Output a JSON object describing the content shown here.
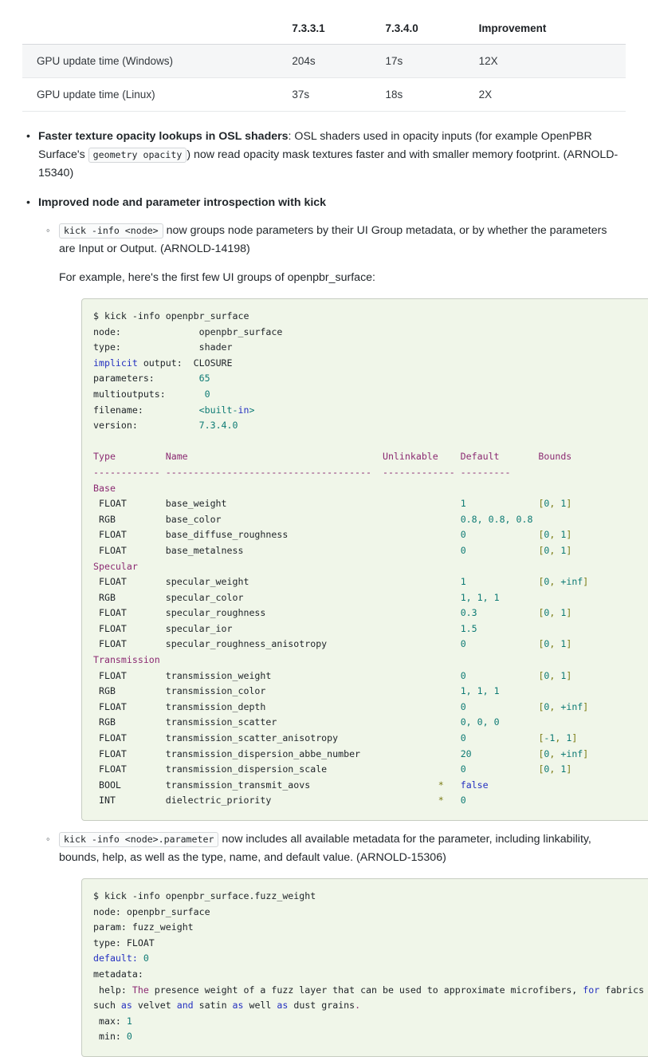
{
  "perf_table": {
    "columns": [
      "",
      "7.3.3.1",
      "7.3.4.0",
      "Improvement"
    ],
    "rows": [
      {
        "label": "GPU update time (Windows)",
        "v731": "204s",
        "v734": "17s",
        "improvement": "12X"
      },
      {
        "label": "GPU update time (Linux)",
        "v731": "37s",
        "v734": "18s",
        "improvement": "2X"
      }
    ]
  },
  "bullets": {
    "item1": {
      "title": "Faster texture opacity lookups in OSL shaders",
      "text_a": ": OSL shaders used in opacity inputs (for example OpenPBR Surface's ",
      "code": "geometry opacity",
      "text_b": ") now read opacity mask textures faster and with smaller memory footprint. (ARNOLD-15340)"
    },
    "item2": {
      "title": "Improved node and parameter introspection with kick",
      "sub1": {
        "code": "kick -info <node>",
        "text": " now groups node parameters by their UI Group metadata, or by whether the parameters are Input or Output. (ARNOLD-14198)",
        "example_intro": "For example, here's the first few UI groups of openpbr_surface:"
      },
      "sub2": {
        "code": "kick -info <node>.parameter",
        "text": " now includes all available metadata for the parameter, including linkability, bounds, help, as well as the type, name, and default value. (ARNOLD-15306)"
      }
    }
  },
  "codeblock1": {
    "command": "$ kick -info openpbr_surface",
    "meta": [
      {
        "key": "node:",
        "key_style": "plain",
        "pad": 14,
        "value": "openpbr_surface",
        "value_style": "plain"
      },
      {
        "key": "type:",
        "key_style": "plain",
        "pad": 14,
        "value": "shader",
        "value_style": "plain"
      },
      {
        "key": "implicit output:",
        "key_style": "kw",
        "pad": 2,
        "value": "CLOSURE",
        "value_style": "plain"
      },
      {
        "key": "parameters:",
        "key_style": "plain",
        "pad": 8,
        "value": "65",
        "value_style": "val"
      },
      {
        "key": "multioutputs:",
        "key_style": "plain",
        "pad": 7,
        "value": "0",
        "value_style": "val"
      },
      {
        "key": "filename:",
        "key_style": "plain",
        "pad": 10,
        "value": "<built-in>",
        "value_style": "builtin"
      },
      {
        "key": "version:",
        "key_style": "plain",
        "pad": 11,
        "value": "7.3.4.0",
        "value_style": "val"
      }
    ],
    "table_headers": [
      "Type",
      "Name",
      "Unlinkable",
      "Default",
      "Bounds"
    ],
    "divider": [
      "------------",
      "-------------------------------------",
      "-------------",
      "---------"
    ],
    "groups": [
      {
        "name": "Base",
        "params": [
          {
            "type": "FLOAT",
            "name": "base_weight",
            "unlinkable": "",
            "default": "1",
            "default_style": "val",
            "bounds": "[0, 1]"
          },
          {
            "type": "RGB",
            "name": "base_color",
            "unlinkable": "",
            "default": "0.8, 0.8, 0.8",
            "default_style": "val",
            "bounds": ""
          },
          {
            "type": "FLOAT",
            "name": "base_diffuse_roughness",
            "unlinkable": "",
            "default": "0",
            "default_style": "val",
            "bounds": "[0, 1]"
          },
          {
            "type": "FLOAT",
            "name": "base_metalness",
            "unlinkable": "",
            "default": "0",
            "default_style": "val",
            "bounds": "[0, 1]"
          }
        ]
      },
      {
        "name": "Specular",
        "params": [
          {
            "type": "FLOAT",
            "name": "specular_weight",
            "unlinkable": "",
            "default": "1",
            "default_style": "val",
            "bounds": "[0, +inf]"
          },
          {
            "type": "RGB",
            "name": "specular_color",
            "unlinkable": "",
            "default": "1, 1, 1",
            "default_style": "val",
            "bounds": ""
          },
          {
            "type": "FLOAT",
            "name": "specular_roughness",
            "unlinkable": "",
            "default": "0.3",
            "default_style": "val",
            "bounds": "[0, 1]"
          },
          {
            "type": "FLOAT",
            "name": "specular_ior",
            "unlinkable": "",
            "default": "1.5",
            "default_style": "val",
            "bounds": ""
          },
          {
            "type": "FLOAT",
            "name": "specular_roughness_anisotropy",
            "unlinkable": "",
            "default": "0",
            "default_style": "val",
            "bounds": "[0, 1]"
          }
        ]
      },
      {
        "name": "Transmission",
        "params": [
          {
            "type": "FLOAT",
            "name": "transmission_weight",
            "unlinkable": "",
            "default": "0",
            "default_style": "val",
            "bounds": "[0, 1]"
          },
          {
            "type": "RGB",
            "name": "transmission_color",
            "unlinkable": "",
            "default": "1, 1, 1",
            "default_style": "val",
            "bounds": ""
          },
          {
            "type": "FLOAT",
            "name": "transmission_depth",
            "unlinkable": "",
            "default": "0",
            "default_style": "val",
            "bounds": "[0, +inf]"
          },
          {
            "type": "RGB",
            "name": "transmission_scatter",
            "unlinkable": "",
            "default": "0, 0, 0",
            "default_style": "val",
            "bounds": ""
          },
          {
            "type": "FLOAT",
            "name": "transmission_scatter_anisotropy",
            "unlinkable": "",
            "default": "0",
            "default_style": "val",
            "bounds": "[-1, 1]"
          },
          {
            "type": "FLOAT",
            "name": "transmission_dispersion_abbe_number",
            "unlinkable": "",
            "default": "20",
            "default_style": "val",
            "bounds": "[0, +inf]"
          },
          {
            "type": "FLOAT",
            "name": "transmission_dispersion_scale",
            "unlinkable": "",
            "default": "0",
            "default_style": "val",
            "bounds": "[0, 1]"
          },
          {
            "type": "BOOL",
            "name": "transmission_transmit_aovs",
            "unlinkable": "*",
            "default": "false",
            "default_style": "kw",
            "bounds": ""
          },
          {
            "type": "INT",
            "name": "dielectric_priority",
            "unlinkable": "*",
            "default": "0",
            "default_style": "val",
            "bounds": ""
          }
        ]
      }
    ]
  },
  "codeblock2": {
    "command": "$ kick -info openpbr_surface.fuzz_weight",
    "lines": [
      {
        "key": "node:",
        "key_style": "plain",
        "value": " openpbr_surface",
        "value_style": "plain"
      },
      {
        "key": "param:",
        "key_style": "plain",
        "value": " fuzz_weight",
        "value_style": "plain"
      },
      {
        "key": "type:",
        "key_style": "plain",
        "value": " FLOAT",
        "value_style": "plain"
      },
      {
        "key": "default:",
        "key_style": "kw",
        "value": " 0",
        "value_style": "val"
      },
      {
        "key": "metadata:",
        "key_style": "plain",
        "value": "",
        "value_style": "plain"
      }
    ],
    "help_label": " help:",
    "help_text_parts": [
      {
        "t": " ",
        "s": "plain"
      },
      {
        "t": "The",
        "s": "pun"
      },
      {
        "t": " presence weight of a fuzz layer that can be used to approximate microfibers, ",
        "s": "plain"
      },
      {
        "t": "for",
        "s": "kw"
      },
      {
        "t": " fabrics such ",
        "s": "plain"
      },
      {
        "t": "as",
        "s": "kw"
      },
      {
        "t": " velvet ",
        "s": "plain"
      },
      {
        "t": "and",
        "s": "kw"
      },
      {
        "t": " satin ",
        "s": "plain"
      },
      {
        "t": "as",
        "s": "kw"
      },
      {
        "t": " well ",
        "s": "plain"
      },
      {
        "t": "as",
        "s": "kw"
      },
      {
        "t": " dust grains",
        "s": "plain"
      },
      {
        "t": ".",
        "s": "pun"
      }
    ],
    "tail": [
      {
        "key": " max:",
        "key_style": "plain",
        "value": " 1",
        "value_style": "val"
      },
      {
        "key": " min:",
        "key_style": "plain",
        "value": " 0",
        "value_style": "val"
      }
    ]
  }
}
